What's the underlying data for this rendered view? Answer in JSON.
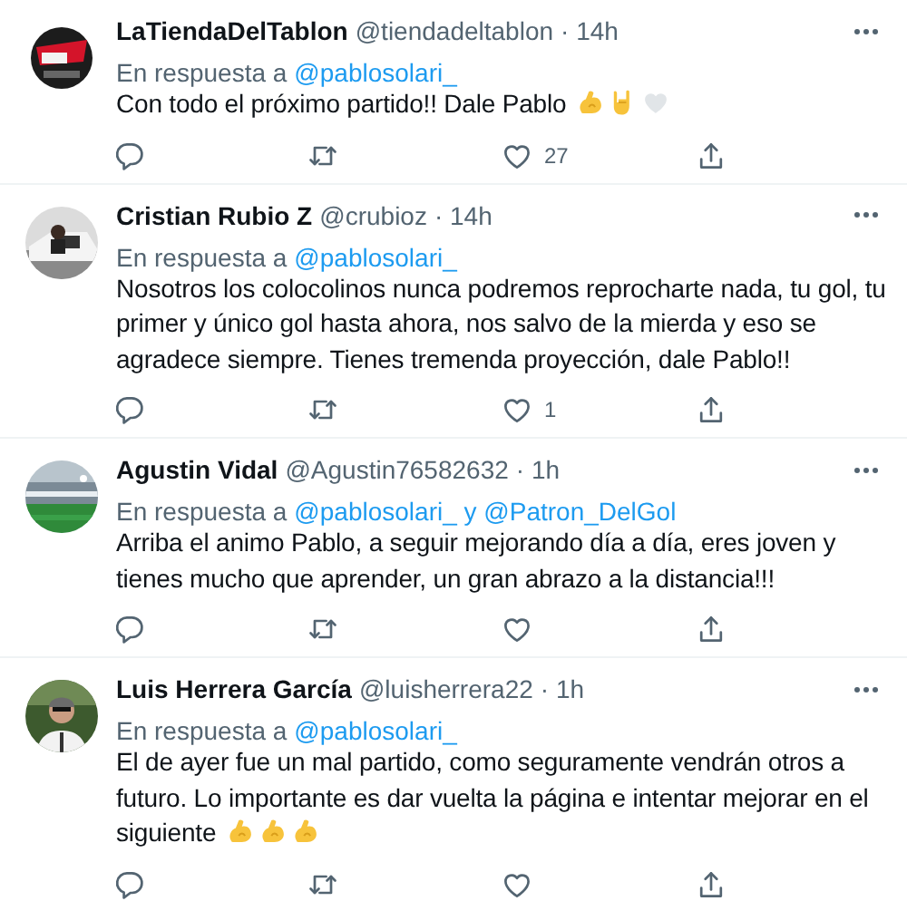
{
  "tweets": [
    {
      "name": "LaTiendaDelTablon",
      "handle": "@tiendadeltablon",
      "time": "· 14h",
      "reply_prefix": "En respuesta a",
      "reply_to": "@pablosolari_",
      "text": "Con todo el próximo partido!! Dale Pablo",
      "emojis": [
        {
          "kind": "muscle"
        },
        {
          "kind": "rock"
        },
        {
          "kind": "heart"
        }
      ],
      "avatar": {
        "kind": "picture"
      },
      "likes": "27"
    },
    {
      "name": "Cristian Rubio Z",
      "handle": "@crubioz",
      "time": "· 14h",
      "reply_prefix": "En respuesta a",
      "reply_to": "@pablosolari_",
      "text": "Nosotros los colocolinos nunca podremos reprocharte nada, tu gol, tu primer y único gol hasta ahora, nos salvo de la mierda y eso se agradece siempre. Tienes tremenda proyección, dale Pablo!!",
      "avatar": {
        "kind": "picture"
      },
      "likes": "1"
    },
    {
      "name": "Agustin Vidal",
      "handle": "@Agustin76582632",
      "time": "· 1h",
      "reply_prefix": "En respuesta a",
      "reply_to": "@pablosolari_ y @Patron_DelGol",
      "text": "Arriba el animo Pablo, a seguir mejorando día a día, eres joven y tienes mucho que aprender, un gran abrazo a la distancia!!!",
      "avatar": {
        "kind": "picture"
      }
    },
    {
      "name": "Luis Herrera García",
      "handle": "@luisherrera22",
      "time": "· 1h",
      "reply_prefix": "En respuesta a",
      "reply_to": "@pablosolari_",
      "text": "El de ayer fue un mal partido, como seguramente vendrán otros a futuro. Lo importante es dar vuelta la página e intentar mejorar en el siguiente",
      "emojis": [
        {
          "kind": "muscle"
        },
        {
          "kind": "muscle"
        },
        {
          "kind": "muscle"
        }
      ],
      "avatar": {
        "kind": "picture"
      }
    }
  ]
}
